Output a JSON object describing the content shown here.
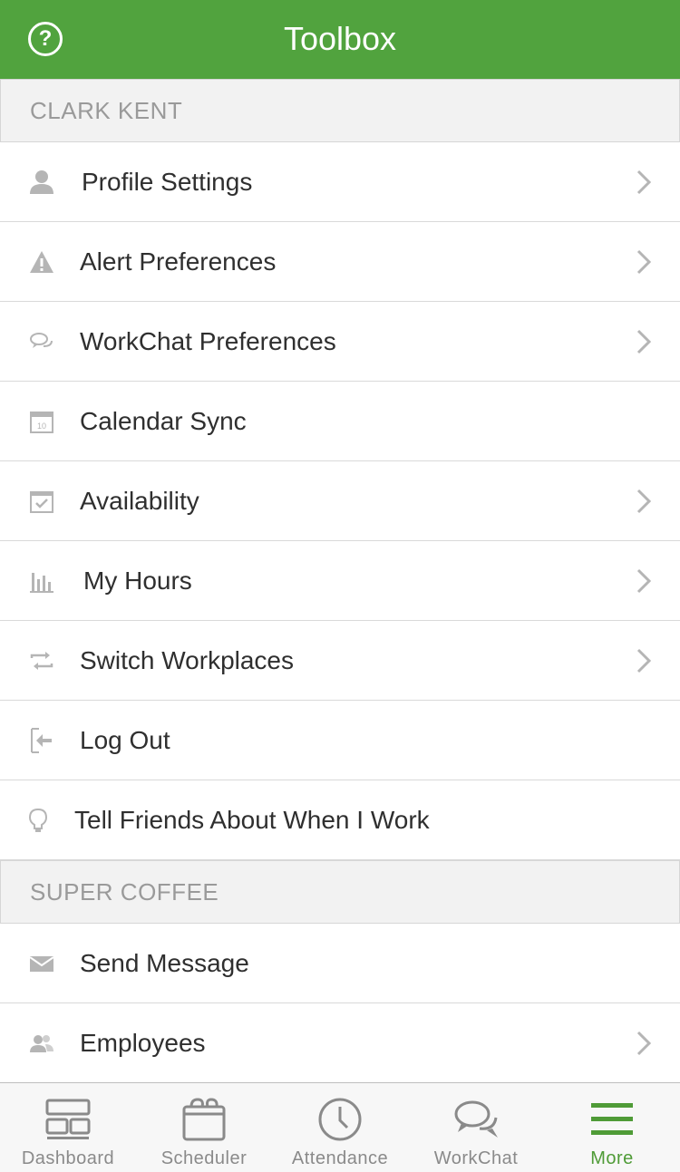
{
  "header": {
    "title": "Toolbox",
    "help_glyph": "?"
  },
  "sections": [
    {
      "title": "CLARK KENT",
      "items": [
        {
          "label": "Profile Settings",
          "icon": "person-icon",
          "chevron": true
        },
        {
          "label": "Alert Preferences",
          "icon": "warning-icon",
          "chevron": true
        },
        {
          "label": "WorkChat Preferences",
          "icon": "chat-bubbles-icon",
          "chevron": true
        },
        {
          "label": "Calendar Sync",
          "icon": "calendar-icon",
          "chevron": false
        },
        {
          "label": "Availability",
          "icon": "calendar-check-icon",
          "chevron": true
        },
        {
          "label": "My Hours",
          "icon": "bar-chart-icon",
          "chevron": true
        },
        {
          "label": "Switch Workplaces",
          "icon": "swap-icon",
          "chevron": true
        },
        {
          "label": "Log Out",
          "icon": "logout-icon",
          "chevron": false
        },
        {
          "label": "Tell Friends About When I Work",
          "icon": "lightbulb-icon",
          "chevron": false
        }
      ]
    },
    {
      "title": "SUPER COFFEE",
      "items": [
        {
          "label": "Send Message",
          "icon": "envelope-icon",
          "chevron": false
        },
        {
          "label": "Employees",
          "icon": "group-icon",
          "chevron": true
        }
      ]
    }
  ],
  "calendar_icon_number": "10",
  "tabbar": {
    "tabs": [
      {
        "label": "Dashboard",
        "icon": "dashboard-icon",
        "active": false
      },
      {
        "label": "Scheduler",
        "icon": "scheduler-icon",
        "active": false
      },
      {
        "label": "Attendance",
        "icon": "clock-icon",
        "active": false
      },
      {
        "label": "WorkChat",
        "icon": "workchat-icon",
        "active": false
      },
      {
        "label": "More",
        "icon": "menu-icon",
        "active": true
      }
    ]
  },
  "colors": {
    "brand_green": "#51a33e",
    "active_tab": "#4f9b37",
    "icon_gray": "#b5b5b5",
    "tab_icon_gray": "#8a8a8a"
  }
}
